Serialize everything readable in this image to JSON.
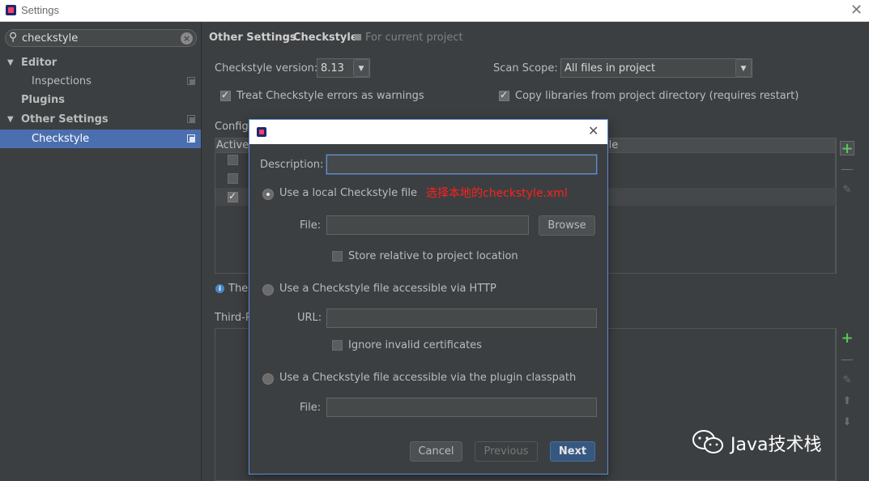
{
  "window": {
    "title": "Settings"
  },
  "sidebar": {
    "search_value": "checkstyle",
    "items": [
      {
        "label": "Editor",
        "arrow": "▼"
      },
      {
        "label": "Inspections"
      },
      {
        "label": "Plugins"
      },
      {
        "label": "Other Settings",
        "arrow": "▼"
      },
      {
        "label": "Checkstyle"
      }
    ]
  },
  "breadcrumb": {
    "part1": "Other Settings",
    "sep": "›",
    "part2": "Checkstyle",
    "scope_note": "For current project"
  },
  "checkstyle": {
    "version_label": "Checkstyle version:",
    "version_value": "8.13",
    "scan_scope_label": "Scan Scope:",
    "scan_scope_value": "All files in project",
    "treat_errors_label": "Treat Checkstyle errors as warnings",
    "copy_libs_label": "Copy libraries from project directory (requires restart)",
    "config_label_partial": "Configu",
    "table_col_active": "Active",
    "table_col_file_partial": "ile",
    "info_partial": "The",
    "third_party_partial": "Third-P"
  },
  "dialog": {
    "description_label": "Description:",
    "description_value": "",
    "local_file_option": "Use a local Checkstyle file",
    "annotation": "选择本地的checkstyle.xml",
    "file_label": "File:",
    "file_value": "",
    "browse_label": "Browse",
    "store_relative_label": "Store relative to project location",
    "http_option": "Use a Checkstyle file accessible via HTTP",
    "url_label": "URL:",
    "url_value": "",
    "ignore_certs_label": "Ignore invalid certificates",
    "classpath_option": "Use a Checkstyle file accessible via the plugin classpath",
    "file2_label": "File:",
    "file2_value": "",
    "cancel_label": "Cancel",
    "previous_label": "Previous",
    "next_label": "Next"
  },
  "watermark": {
    "text": "Java技术栈"
  },
  "icons": {
    "search": "search-icon",
    "clear": "clear-icon",
    "close": "close-icon",
    "add": "plus-icon",
    "remove": "minus-icon",
    "edit": "pencil-icon",
    "up": "arrow-up-icon",
    "down": "arrow-down-icon",
    "info": "info-icon",
    "copy": "project-scope-icon"
  },
  "colors": {
    "selection": "#4b6eaf",
    "accent_add": "#5bc45b",
    "annotation": "#ff2020",
    "primary_button": "#365880"
  }
}
